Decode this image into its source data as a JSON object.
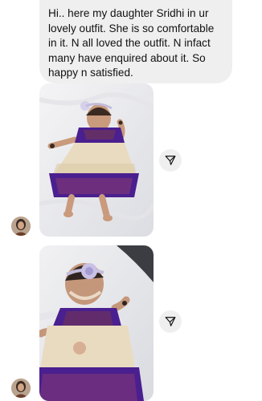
{
  "conversation": {
    "message": {
      "text": "Hi.. here my daughter Sridhi in  ur lovely outfit. She is so comfortable in it. N all loved the outfit. N infact many have enquired about it. So happy n satisfied."
    },
    "photos": [
      {
        "kind": "photo",
        "subject": "baby in cream and purple silk dress, full view"
      },
      {
        "kind": "photo",
        "subject": "baby in cream and purple silk dress, closer view"
      }
    ],
    "share_icon": "paper-plane-icon",
    "avatar_icon": "profile-avatar",
    "colors": {
      "bubble": "#efefef",
      "text": "#111111",
      "dress_purple": "#4a1f8f",
      "dress_cream": "#e9dbc0",
      "background": "#ffffff"
    }
  }
}
